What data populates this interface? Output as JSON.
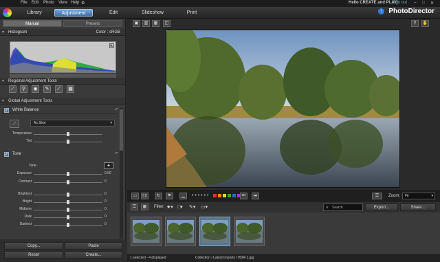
{
  "menu": {
    "file": "File",
    "edit": "Edit",
    "photo": "Photo",
    "view": "View",
    "help": "Help"
  },
  "header": {
    "promo": "Hello CREATE and PLAY!",
    "signout": "Sign out",
    "brand": "PhotoDirector"
  },
  "tabs": [
    {
      "label": "Library"
    },
    {
      "label": "Adjustment"
    },
    {
      "label": "Edit"
    },
    {
      "label": "Slideshow"
    },
    {
      "label": "Print"
    }
  ],
  "panel": {
    "subtabs": [
      {
        "label": "Manual"
      },
      {
        "label": "Presets"
      }
    ],
    "histogram": {
      "title": "Histogram",
      "color_label": "Color : sRGB"
    },
    "regional": {
      "title": "Regional Adjustment Tools"
    },
    "global": {
      "title": "Global Adjustment Tools"
    },
    "white_balance": {
      "title": "White Balance",
      "preset": "As Shot",
      "sliders": [
        {
          "label": "Temperature",
          "value": "",
          "level": 0.5
        },
        {
          "label": "Tint",
          "value": "",
          "level": 0.5
        }
      ]
    },
    "tone": {
      "title": "Tone",
      "subtitle": "Tone",
      "sliders": [
        {
          "label": "Exposure",
          "value": "0.00",
          "level": 0.5
        },
        {
          "label": "Contrast",
          "value": "0",
          "level": 0.5
        },
        {
          "label": "Brightest",
          "value": "0",
          "level": 0.5
        },
        {
          "label": "Bright",
          "value": "0",
          "level": 0.5
        },
        {
          "label": "Midtone",
          "value": "0",
          "level": 0.5
        },
        {
          "label": "Dark",
          "value": "0",
          "level": 0.5
        },
        {
          "label": "Darkest",
          "value": "0",
          "level": 0.5
        }
      ]
    },
    "buttons": {
      "copy": "Copy...",
      "paste": "Paste",
      "reset": "Reset",
      "create": "Create..."
    }
  },
  "viewer_toolbar": {
    "zoom_label": "Zoom:",
    "zoom_value": "Fit",
    "dots": "• • • • • •",
    "colors": [
      "#d33",
      "#e80",
      "#dd2",
      "#3a3",
      "#36c",
      "#a3c",
      "#777"
    ]
  },
  "filmstrip_toolbar": {
    "filter": "Filter:",
    "search_placeholder": "Search",
    "export": "Export...",
    "share": "Share..."
  },
  "status": {
    "left": "1 selected - 4 displayed",
    "right": "Collection / Latest Imports / HDR-1.jpg"
  },
  "thumbnails": [
    {
      "selected": false
    },
    {
      "selected": false
    },
    {
      "selected": true
    },
    {
      "selected": false
    }
  ]
}
